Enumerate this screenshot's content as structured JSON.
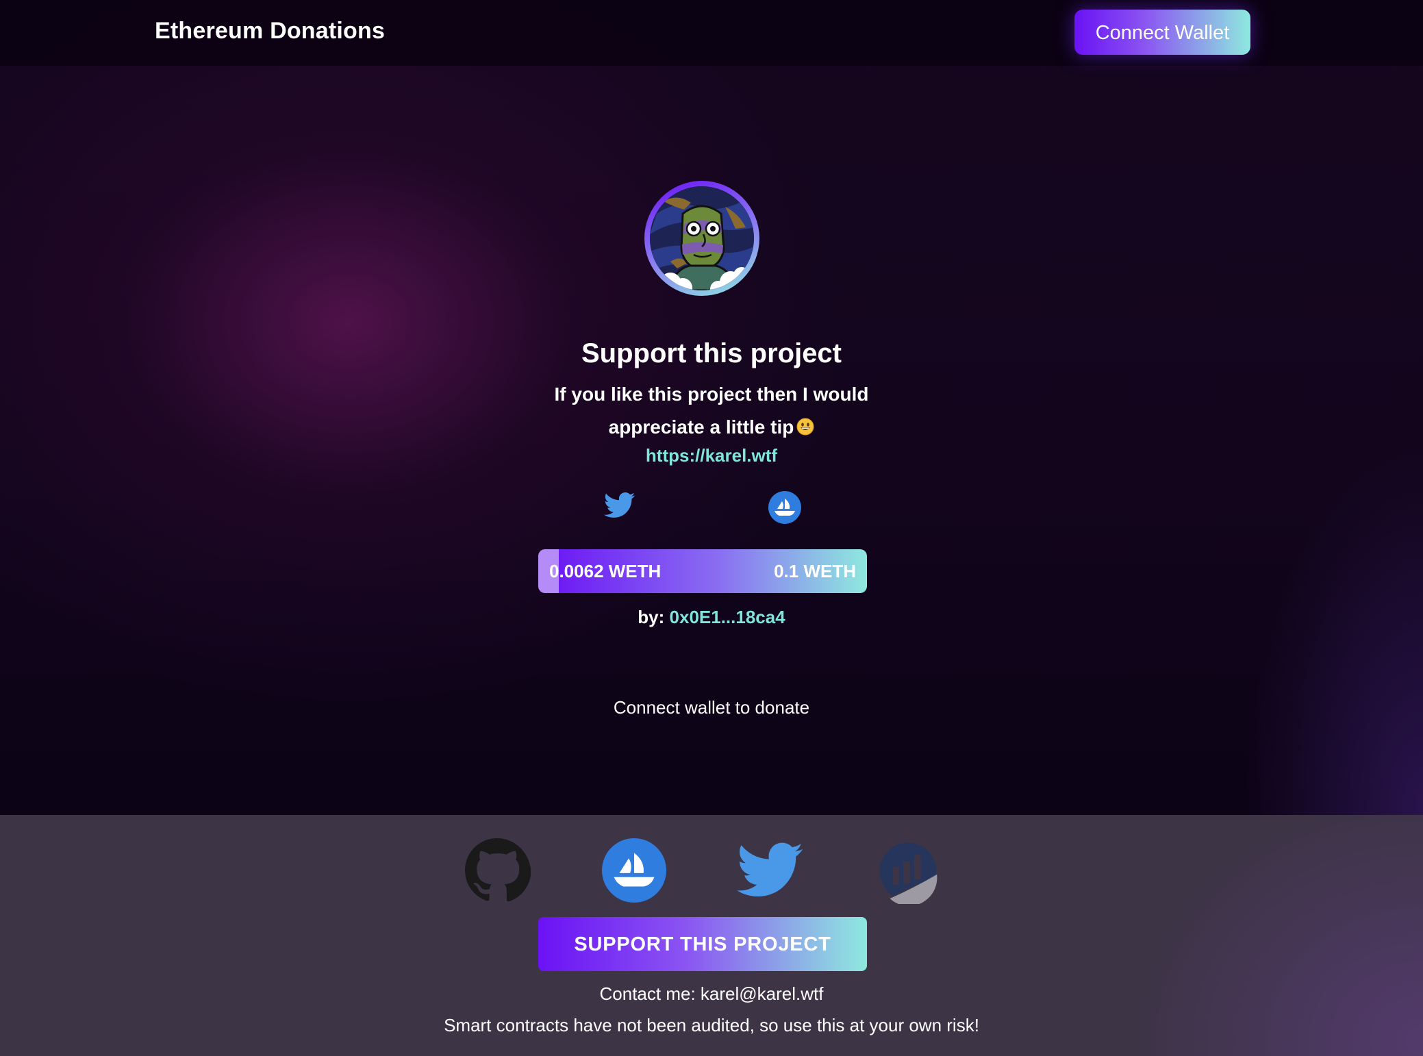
{
  "header": {
    "brand": "Ethereum Donations",
    "connect_wallet_label": "Connect Wallet"
  },
  "project": {
    "avatar_icon": "nft-avatar-image",
    "title": "Support this project",
    "description": "If you like this project then I would appreciate a little tip",
    "description_emoji": "grinning-face-emoji",
    "website": "https://karel.wtf",
    "social_links": [
      "twitter-icon",
      "opensea-icon"
    ]
  },
  "donation": {
    "current": "0.0062 WETH",
    "goal": "0.1 WETH",
    "progress_fraction": 0.062,
    "by_label": "by:",
    "by_address": "0x0E1...18ca4",
    "connect_note": "Connect wallet to donate"
  },
  "footer": {
    "links": [
      "github-icon",
      "opensea-icon",
      "twitter-icon",
      "etherscan-icon"
    ],
    "support_label": "SUPPORT THIS PROJECT",
    "contact": "Contact me: karel@karel.wtf",
    "disclaimer": "Smart contracts have not been audited, so use this at your own risk!"
  },
  "colors": {
    "accent_start": "#6a12f5",
    "accent_end": "#8ee9df",
    "link": "#7ee7d9",
    "footer_bg": "#3d3446",
    "twitter": "#4a99e9",
    "opensea": "#2f7ddf"
  }
}
